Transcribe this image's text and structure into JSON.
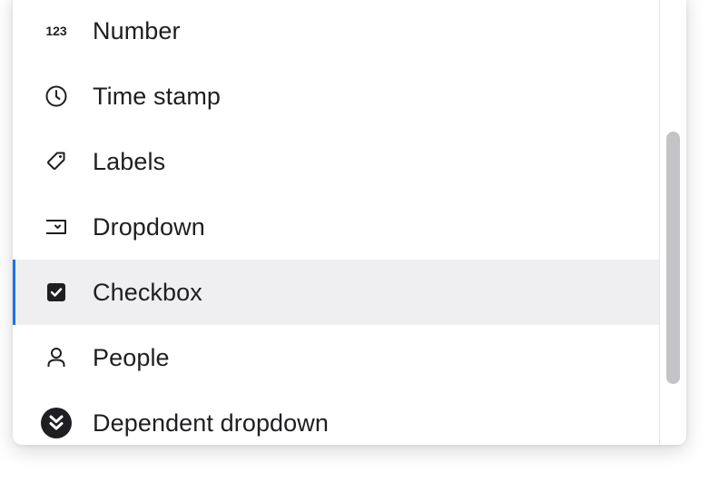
{
  "menu": {
    "items": [
      {
        "label": "Number",
        "icon": "number-icon"
      },
      {
        "label": "Time stamp",
        "icon": "clock-icon"
      },
      {
        "label": "Labels",
        "icon": "tag-icon"
      },
      {
        "label": "Dropdown",
        "icon": "dropdown-icon"
      },
      {
        "label": "Checkbox",
        "icon": "checkbox-icon",
        "selected": true
      },
      {
        "label": "People",
        "icon": "person-icon"
      },
      {
        "label": "Dependent dropdown",
        "icon": "double-chevron-down-icon"
      }
    ],
    "number_icon_text": "123"
  },
  "colors": {
    "selected_background": "#efeff1",
    "selection_accent": "#1f6feb",
    "text": "#1f1f22",
    "scrollbar_thumb": "#c4c4c6"
  }
}
